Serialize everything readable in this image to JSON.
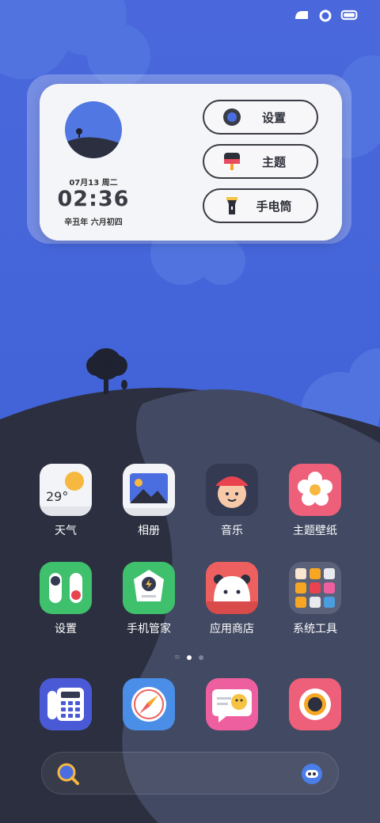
{
  "status_bar": {
    "icons": [
      "network-icon",
      "refresh-icon",
      "battery-icon"
    ]
  },
  "widget": {
    "date": "07月13 周二",
    "time": "02:36",
    "lunar": "辛丑年 六月初四",
    "buttons": [
      {
        "label": "设置",
        "icon": "gear-icon"
      },
      {
        "label": "主题",
        "icon": "paintbrush-icon"
      },
      {
        "label": "手电筒",
        "icon": "flashlight-icon"
      }
    ]
  },
  "apps": {
    "row1": [
      {
        "label": "天气",
        "icon": "weather-icon",
        "temp": "29°"
      },
      {
        "label": "相册",
        "icon": "gallery-icon"
      },
      {
        "label": "音乐",
        "icon": "music-icon"
      },
      {
        "label": "主题壁纸",
        "icon": "flower-icon"
      }
    ],
    "row2": [
      {
        "label": "设置",
        "icon": "toggle-icon"
      },
      {
        "label": "手机管家",
        "icon": "shield-bolt-icon"
      },
      {
        "label": "应用商店",
        "icon": "panda-icon"
      },
      {
        "label": "系统工具",
        "icon": "folder-icon"
      }
    ]
  },
  "dock": [
    {
      "icon": "phone-icon"
    },
    {
      "icon": "compass-icon"
    },
    {
      "icon": "message-icon"
    },
    {
      "icon": "camera-icon"
    }
  ],
  "colors": {
    "sky": "#3e63d8",
    "hill_dark": "#2b2f3f",
    "hill_mid": "#414861"
  }
}
